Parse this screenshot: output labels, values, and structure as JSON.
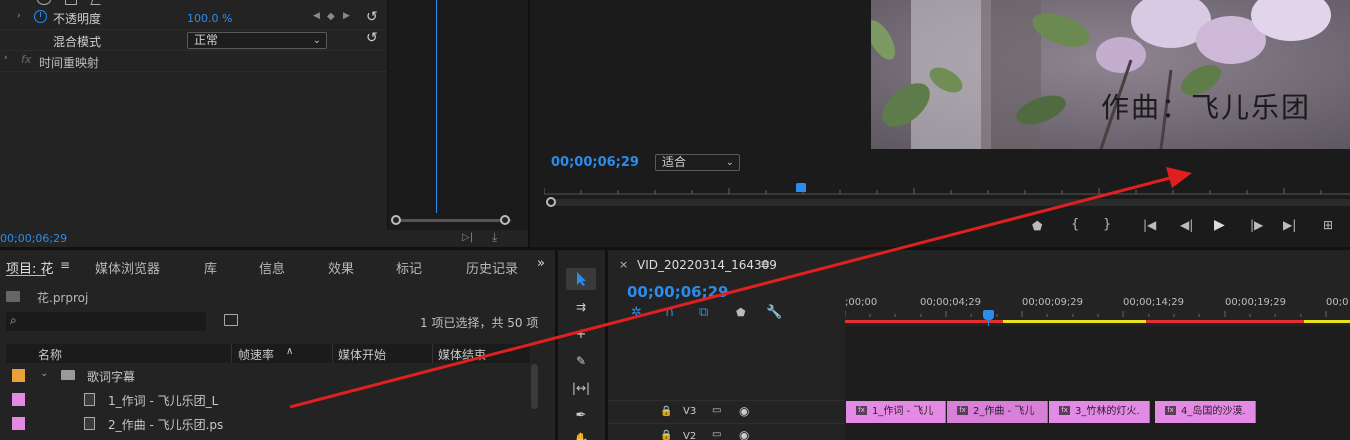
{
  "effect_controls": {
    "opacity_label": "不透明度",
    "opacity_value": "100.0 %",
    "blend_label": "混合模式",
    "blend_value": "正常",
    "time_remap_label": "时间重映射",
    "fx_badge": "fx",
    "timecode": "00;00;06;29"
  },
  "program": {
    "timecode": "00;00;06;29",
    "fit_value": "适合",
    "overlay_text": "作曲：飞儿乐团"
  },
  "project": {
    "tabs": [
      "项目: 花",
      "媒体浏览器",
      "库",
      "信息",
      "效果",
      "标记",
      "历史记录"
    ],
    "file_name": "花.prproj",
    "selection_status": "1 项已选择，共 50 项",
    "columns": [
      "名称",
      "帧速率",
      "媒体开始",
      "媒体结束"
    ],
    "rows": [
      {
        "name": "歌词字幕",
        "type": "folder",
        "color": "#e8a23a"
      },
      {
        "name": "1_作词 - 飞儿乐团_L",
        "type": "psd",
        "color": "#e38be4"
      },
      {
        "name": "2_作曲 - 飞儿乐团.ps",
        "type": "psd",
        "color": "#e38be4"
      }
    ]
  },
  "timeline": {
    "sequence_name": "VID_20220314_164309",
    "timecode": "00;00;06;29",
    "ruler": [
      ";00;00",
      "00;00;04;29",
      "00;00;09;29",
      "00;00;14;29",
      "00;00;19;29",
      "00;0"
    ],
    "tracks": [
      "V3",
      "V2"
    ],
    "clips": [
      "1_作词 - 飞儿",
      "2_作曲 - 飞儿",
      "3_竹林的灯火.",
      "4_岛国的沙漠."
    ]
  },
  "colors": {
    "accent_blue": "#2d8ceb",
    "clip_pink": "#e38be4",
    "folder_orange": "#e8a23a",
    "arrow_red": "#e02020"
  }
}
